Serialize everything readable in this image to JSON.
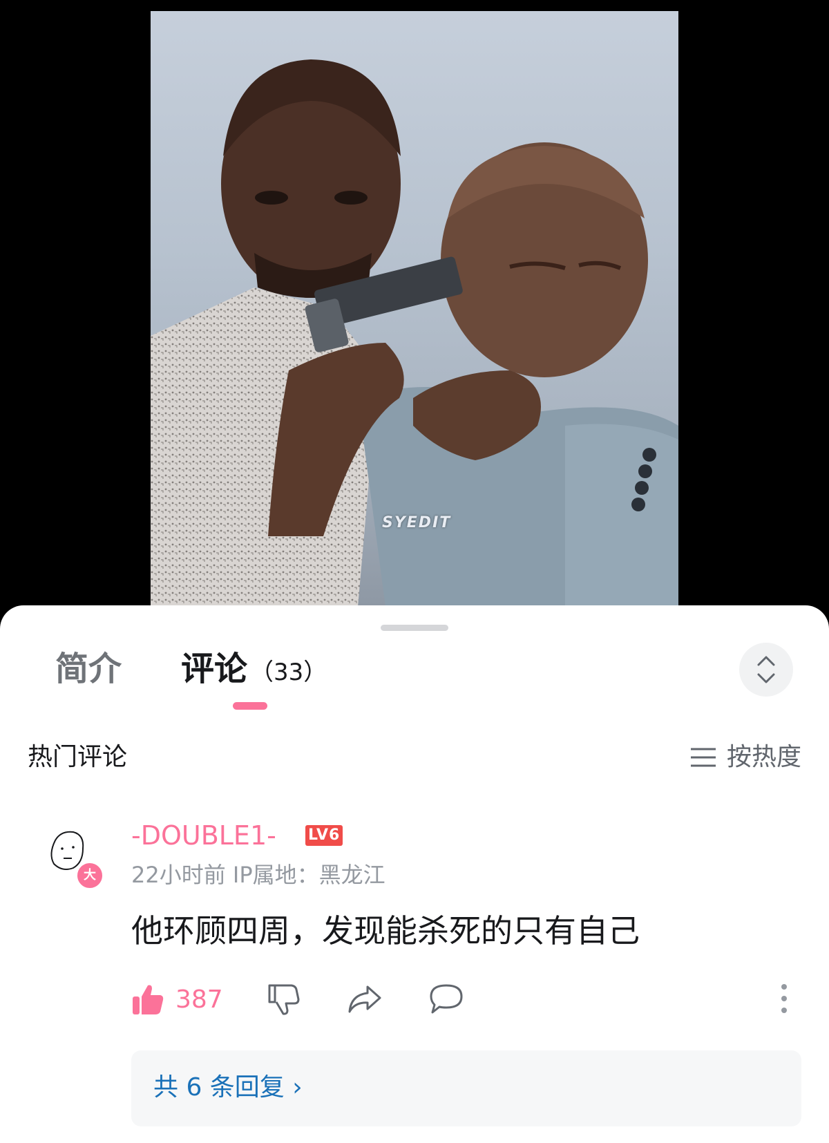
{
  "video": {
    "watermark": "SYEDIT"
  },
  "tabs": {
    "intro_label": "简介",
    "comments_label": "评论",
    "comments_count": "（33）",
    "active": "comments",
    "accent_color": "#fb7299"
  },
  "icons": {
    "expand": "chevron-up-down-icon",
    "sort": "menu-lines-icon",
    "like": "thumbs-up-icon",
    "dislike": "thumbs-down-icon",
    "share": "share-arrow-icon",
    "reply": "speech-bubble-icon",
    "more": "vertical-dots-icon"
  },
  "comments_section": {
    "title": "热门评论",
    "sort_label": "按热度",
    "items": [
      {
        "username": "-DOUBLE1-",
        "username_color": "#fb7299",
        "level": "LV6",
        "avatar_badge": "大",
        "time": "22小时前",
        "ip_location": "IP属地：黑龙江",
        "text": "他环顾四周，发现能杀死的只有自己",
        "likes": "387",
        "replies_link": "共 6 条回复 ›"
      }
    ]
  }
}
